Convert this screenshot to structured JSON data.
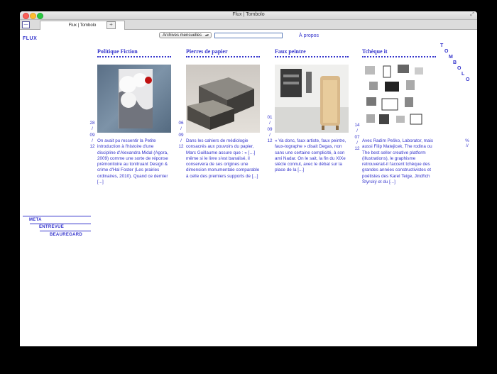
{
  "window": {
    "title": "Flux | Tombolo"
  },
  "tab": {
    "label": "Flux | Tombolo",
    "new_tab": "+"
  },
  "header": {
    "brand": "FLUX",
    "archive_select": "Archives mensuelles",
    "search_placeholder": "",
    "about_link": "À propos",
    "vertical_title": [
      "T",
      "O",
      "M",
      "B",
      "O",
      "L",
      "O"
    ]
  },
  "posts": [
    {
      "title": "Politique Fiction",
      "date": [
        "28",
        "/",
        "09",
        "/",
        "12"
      ],
      "excerpt": "On avait pu ressentir la Petite introduction à l'histoire d'une discipline d'Alexandra Midal (Agora, 2009) comme une sorte de réponse prémonitoire au tonitruant Design & crime d'Hal Foster (Les prairies ordinaires, 2010). Quand ce dernier [...]"
    },
    {
      "title": "Pierres de papier",
      "date": [
        "06",
        "/",
        "09",
        "/",
        "12"
      ],
      "excerpt": "Dans les cahiers de médiologie consacrés aux pouvoirs du papier, Marc Guillaume assure que : « […] même si le livre s'est banalisé, il conservera de ses origines une dimension monumentale comparable à celle des premiers supports de [...]"
    },
    {
      "title": "Faux peintre",
      "date": [
        "01",
        "/",
        "09",
        "/",
        "12"
      ],
      "excerpt": "« Va donc, faux artiste, faux peintre, faux-tographe » disait Degas, non sans une certaine complicité, à son ami Nadar. On le sait, la fin du XIXe siècle connut, avec le débat sur la place de la [...]"
    },
    {
      "title": "Tchèque it",
      "date": [
        "14",
        "/",
        "07",
        "/",
        "12"
      ],
      "excerpt": "Avec Radim Peško, Laborator, mais aussi Filip Matejicek, The rodina ou The best seller creative platform (illustrations), le graphisme retrouverait-il l'accent tchèque des grandes années constructivistes et poétistes des Karel Teige, Jindřich Štyrský et du [...]"
    }
  ],
  "side_marker": [
    "%",
    "//"
  ],
  "meta_nav": {
    "items": [
      "META",
      "ENTREVUE",
      "BEAUREGARD"
    ]
  },
  "colors": {
    "accent": "#3333cc"
  }
}
